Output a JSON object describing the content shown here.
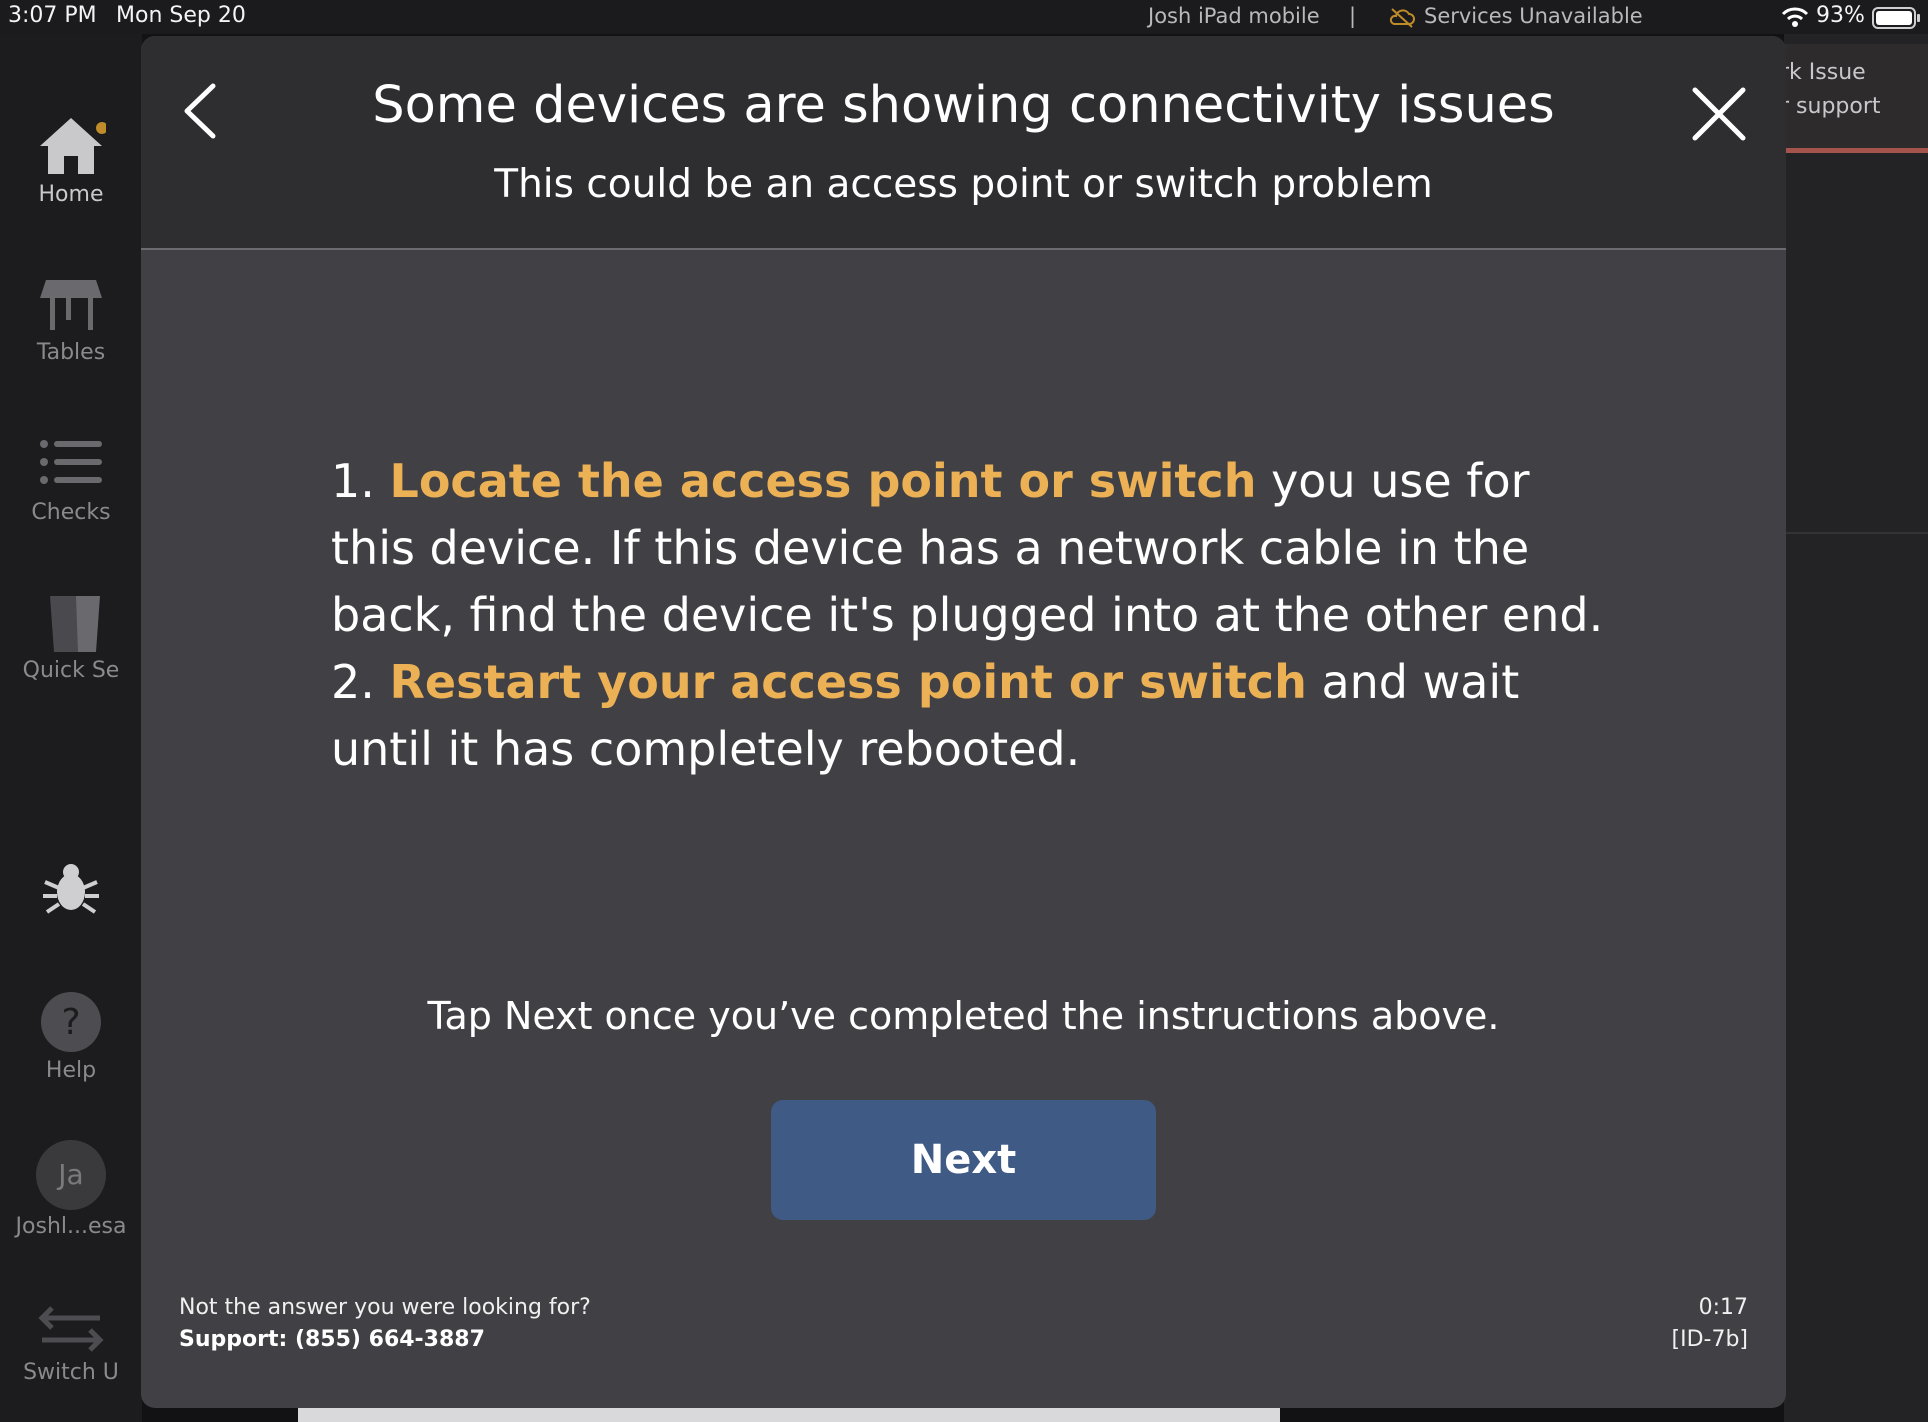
{
  "status_bar": {
    "time": "3:07 PM",
    "date": "Mon Sep 20",
    "device_name": "Josh iPad mobile",
    "separator": "|",
    "services_status": "Services Unavailable",
    "battery_percent": "93%",
    "icons": [
      "wifi-icon",
      "battery-icon",
      "cloud-off-icon"
    ]
  },
  "sidebar": {
    "items": [
      {
        "label": "Home",
        "icon": "home-icon"
      },
      {
        "label": "Tables",
        "icon": "table-icon"
      },
      {
        "label": "Checks",
        "icon": "list-icon"
      },
      {
        "label": "Quick Se",
        "icon": "quick-service-icon"
      },
      {
        "label": "",
        "icon": "bug-icon"
      },
      {
        "label": "Help",
        "icon": "help-icon"
      },
      {
        "label": "Joshl...esa",
        "avatar_initials": "Ja"
      },
      {
        "label": "Switch U",
        "icon": "switch-user-icon"
      }
    ]
  },
  "background_notice": {
    "line1": "rk Issue",
    "line2": "r support"
  },
  "modal": {
    "title": "Some devices are showing connectivity issues",
    "subtitle": "This could be an access point or switch problem",
    "steps": [
      {
        "number": "1.",
        "highlight": "Locate the access point or switch",
        "text": "you use for this device. If this device has a network cable in the back, find the device it's plugged into at the other end."
      },
      {
        "number": "2.",
        "highlight": "Restart your access point or switch",
        "text": "and wait until it has completely rebooted."
      }
    ],
    "tap_next_text": "Tap Next once you’ve completed the instructions above.",
    "next_button_label": "Next",
    "footer": {
      "question": "Not the answer you were looking for?",
      "support": "Support: (855) 664-3887",
      "timer": "0:17",
      "id": "[ID-7b]"
    }
  },
  "colors": {
    "highlight": "#ecb155",
    "next_button": "#3e5a85",
    "modal_bg": "#414145",
    "header_bg": "#2e2e31"
  }
}
